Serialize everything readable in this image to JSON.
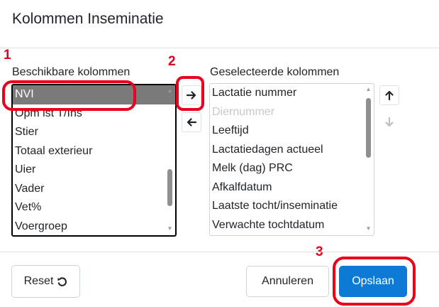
{
  "dialog": {
    "title": "Kolommen Inseminatie"
  },
  "annotations": {
    "step1": "1",
    "step2": "2",
    "step3": "3"
  },
  "available": {
    "label": "Beschikbare kolommen",
    "items": [
      "NVI",
      "Opm lst T/Ins",
      "Stier",
      "Totaal exterieur",
      "Uier",
      "Vader",
      "Vet%",
      "Voergroep"
    ],
    "selected_item": "NVI"
  },
  "selected": {
    "label": "Geselecteerde kolommen",
    "items": [
      "Lactatie nummer",
      "Diernummer",
      "Leeftijd",
      "Lactatiedagen actueel",
      "Melk (dag) PRC",
      "Afkalfdatum",
      "Laatste tocht/inseminatie",
      "Verwachte tochtdatum"
    ],
    "disabled_item": "Diernummer"
  },
  "controls": {
    "move_right_icon": "arrow-right-icon",
    "move_left_icon": "arrow-left-icon",
    "move_up_icon": "arrow-up-icon",
    "move_down_icon": "arrow-down-icon"
  },
  "footer": {
    "reset_label": "Reset",
    "reset_icon": "undo-icon",
    "cancel_label": "Annuleren",
    "save_label": "Opslaan"
  },
  "colors": {
    "accent": "#0d7ad6",
    "highlight": "#e8001c",
    "selected_row": "#7a7a7a"
  }
}
